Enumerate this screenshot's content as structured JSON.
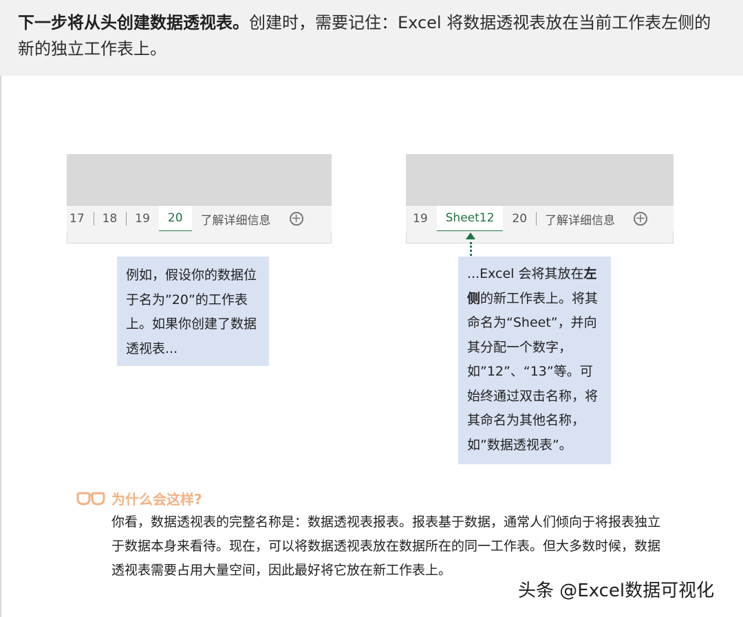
{
  "header": {
    "bold_text": "下一步将从头创建数据透视表。",
    "rest_text": "创建时，需要记住：Excel 将数据透视表放在当前工作表左侧的新的独立工作表上。"
  },
  "left_sheet": {
    "tabs": [
      {
        "label": "17",
        "active": false
      },
      {
        "label": "18",
        "active": false
      },
      {
        "label": "19",
        "active": false
      },
      {
        "label": "20",
        "active": true
      },
      {
        "label": "了解详细信息",
        "active": false
      }
    ]
  },
  "right_sheet": {
    "tabs": [
      {
        "label": "19",
        "active": false
      },
      {
        "label": "Sheet12",
        "active": true
      },
      {
        "label": "20",
        "active": false
      },
      {
        "label": "了解详细信息",
        "active": false
      }
    ]
  },
  "left_callout": {
    "text": "例如，假设你的数据位于名为”20”的工作表上。如果你创建了数据透视表..."
  },
  "right_callout": {
    "part1": "...Excel 会将其放在",
    "bold": "左侧",
    "part2": "的新工作表上。将其命名为“Sheet”，并向其分配一个数字，如”12”、“13”等。可始终通过双击名称，将其命名为其他名称，如”数据透视表”。"
  },
  "why": {
    "title": "为什么会这样?",
    "body": "你看，数据透视表的完整名称是：数据透视表报表。报表基于数据，通常人们倾向于将报表独立于数据本身来看待。现在，可以将数据透视表放在数据所在的同一工作表。但大多数时候，数据透视表需要占用大量空间，因此最好将它放在新工作表上。"
  },
  "watermark": "头条 @Excel数据可视化",
  "colors": {
    "accent_green": "#217346",
    "callout_bg": "#d9e2f3",
    "why_orange": "#f4b183",
    "header_bg": "#f1f1f1"
  },
  "icons": [
    "plus-circle-icon",
    "glasses-icon",
    "arrow-up-icon"
  ]
}
